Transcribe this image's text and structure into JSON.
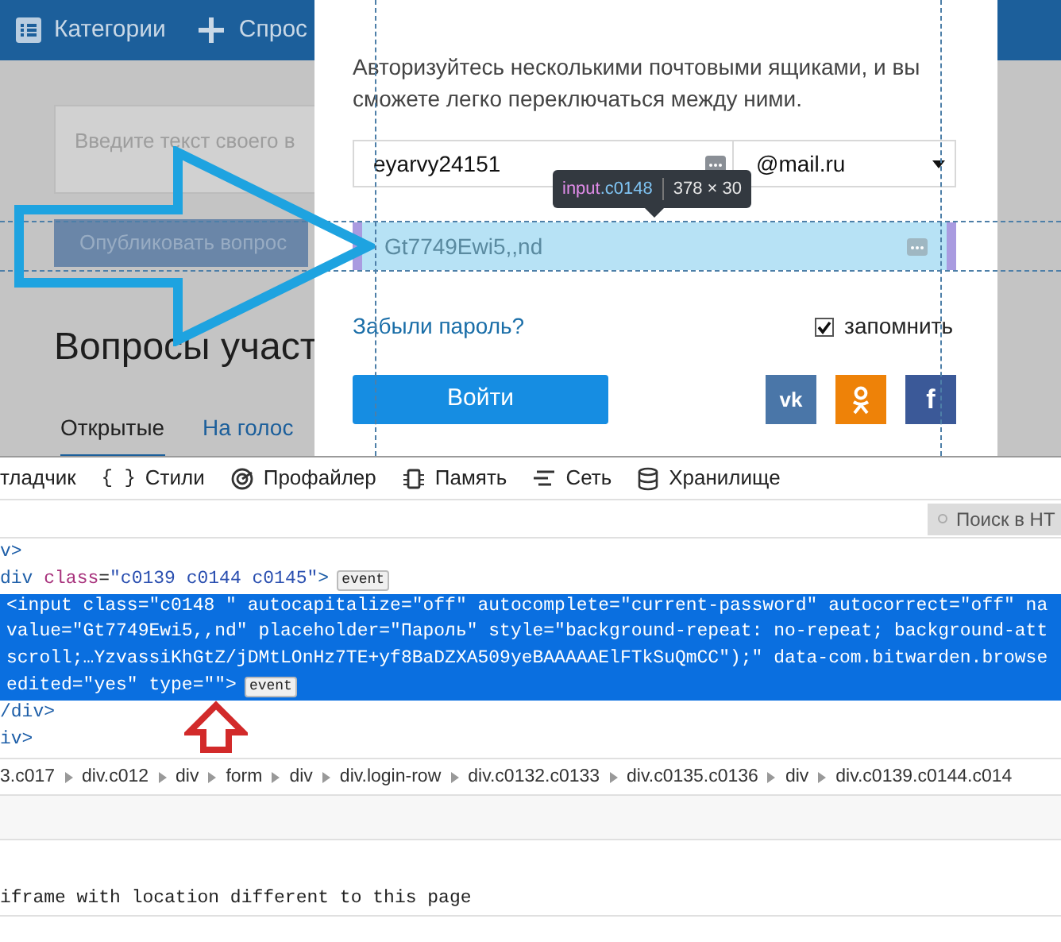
{
  "page": {
    "header": {
      "categories": "Категории",
      "ask": "Спрос"
    },
    "question_placeholder": "Введите текст своего в",
    "publish_button": "Опубликовать вопрос",
    "heading": "Вопросы участ",
    "tabs": [
      {
        "label": "Открытые",
        "selected": true
      },
      {
        "label": "На голос",
        "selected": false
      }
    ]
  },
  "dialog": {
    "description": "Авторизуйтесь несколькими почтовыми ящиками, и вы сможете легко переключаться между ними.",
    "login": "eyarvy24151",
    "domain": "@mail.ru",
    "password": "Gt7749Ewi5,,nd",
    "highlighted": true,
    "forgot_link": "Забыли пароль?",
    "remember": {
      "label": "запомнить",
      "checked": true
    },
    "submit": "Войти",
    "social": [
      {
        "kind": "vk",
        "label": "vk"
      },
      {
        "kind": "ok"
      },
      {
        "kind": "facebook",
        "label": "f"
      }
    ]
  },
  "inspector_tooltip": {
    "element": "input",
    "class": ".c0148",
    "size": "378 × 30"
  },
  "devtools": {
    "tabs": [
      {
        "kind": "debugger",
        "label": "тладчик"
      },
      {
        "kind": "styles",
        "icon_text": "{ }",
        "label": "Стили"
      },
      {
        "kind": "profiler",
        "label": "Профайлер"
      },
      {
        "kind": "memory",
        "label": "Память"
      },
      {
        "kind": "network",
        "label": "Сеть"
      },
      {
        "kind": "storage",
        "label": "Хранилище"
      }
    ],
    "search_placeholder": "Поиск в HT",
    "lines": [
      {
        "selected": false,
        "segments": [
          {
            "kind": "tag",
            "text": "v>"
          }
        ]
      },
      {
        "selected": false,
        "segments": [
          {
            "kind": "tag",
            "text": "div "
          },
          {
            "kind": "attr",
            "text": "class"
          },
          {
            "kind": "plain",
            "text": "="
          },
          {
            "kind": "value",
            "text": "\"c0139 c0144 c0145\""
          },
          {
            "kind": "tag",
            "text": ">"
          }
        ],
        "badge": "event"
      },
      {
        "selected": true,
        "segments": [
          {
            "kind": "plain",
            "text": "<input class=\"c0148 \" autocapitalize=\"off\" autocomplete=\"current-password\" autocorrect=\"off\" na"
          }
        ]
      },
      {
        "selected": true,
        "segments": [
          {
            "kind": "plain",
            "text": "value=\"Gt7749Ewi5,,nd\" placeholder=\"Пароль\" style=\"background-repeat: no-repeat; background-att"
          }
        ]
      },
      {
        "selected": true,
        "segments": [
          {
            "kind": "plain",
            "text": "scroll;…YzvassiKhGtZ/jDMtLOnHz7TE+yf8BaDZXA509yeBAAAAAElFTkSuQmCC\");\" data-com.bitwarden.browse"
          }
        ]
      },
      {
        "selected": true,
        "segments": [
          {
            "kind": "plain",
            "text": "edited=\"yes\" type=\"\">"
          }
        ],
        "badge": "event"
      },
      {
        "selected": false,
        "segments": [
          {
            "kind": "tag",
            "text": "/div>"
          }
        ]
      },
      {
        "selected": false,
        "segments": [
          {
            "kind": "tag",
            "text": "iv>"
          }
        ]
      }
    ],
    "breadcrumbs": [
      "3.c017",
      "div.c012",
      "div",
      "form",
      "div",
      "div.login-row",
      "div.c0132.c0133",
      "div.c0135.c0136",
      "div",
      "div.c0139.c0144.c014"
    ],
    "console_message": "iframe with location different to this page"
  }
}
